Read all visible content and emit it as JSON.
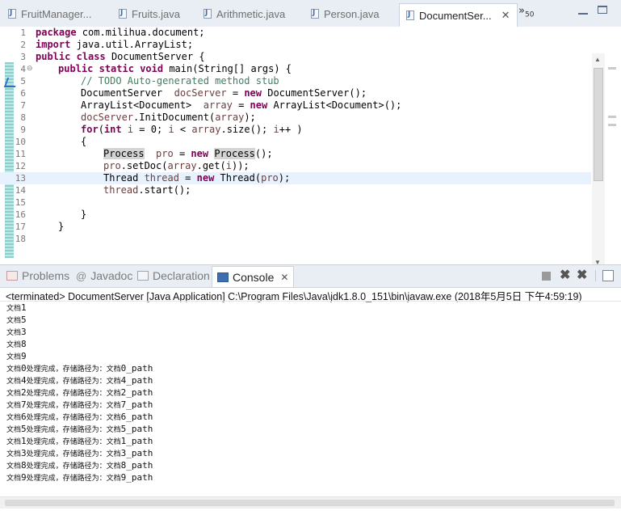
{
  "editor_tabs": [
    {
      "label": "FruitManager..."
    },
    {
      "label": "Fruits.java"
    },
    {
      "label": "Arithmetic.java"
    },
    {
      "label": "Person.java"
    },
    {
      "label": "DocumentSer..."
    }
  ],
  "overflow": {
    "symbol": "»",
    "count": "50"
  },
  "code_lines": [
    {
      "n": "1"
    },
    {
      "n": "2"
    },
    {
      "n": "3"
    },
    {
      "n": "4"
    },
    {
      "n": "5"
    },
    {
      "n": "6"
    },
    {
      "n": "7"
    },
    {
      "n": "8"
    },
    {
      "n": "9"
    },
    {
      "n": "10"
    },
    {
      "n": "11"
    },
    {
      "n": "12"
    },
    {
      "n": "13"
    },
    {
      "n": "14"
    },
    {
      "n": "15"
    },
    {
      "n": "16"
    },
    {
      "n": "17"
    },
    {
      "n": "18"
    }
  ],
  "code": {
    "l1": {
      "kw": "package",
      "rest": " com.milihua.document;"
    },
    "l2": {
      "kw": "import",
      "rest": " java.util.ArrayList;"
    },
    "l3": {
      "kw1": "public",
      "kw2": "class",
      "rest": " DocumentServer {"
    },
    "l4": {
      "kw1": "public",
      "kw2": "static",
      "kw3": "void",
      "rest": " main(String[] args) {"
    },
    "l5": {
      "comment": "// TODO Auto-generated method stub"
    },
    "l6": {
      "a": "DocumentServer  ",
      "var": "docServer",
      "b": " = ",
      "kw": "new",
      "c": " DocumentServer();"
    },
    "l7": {
      "a": "ArrayList<Document>  ",
      "var": "array",
      "b": " = ",
      "kw": "new",
      "c": " ArrayList<Document>();"
    },
    "l8": {
      "var": "docServer",
      "a": ".InitDocument(",
      "var2": "array",
      "b": ");"
    },
    "l9": {
      "kw": "for",
      "a": "(",
      "kw2": "int",
      "b": " ",
      "var": "i",
      "c": " = 0; ",
      "var2": "i",
      "d": " < ",
      "var3": "array",
      "e": ".size(); ",
      "var4": "i",
      "f": "++ )"
    },
    "l10": {
      "a": "{"
    },
    "l11": {
      "mk1": "Process",
      "a": "  ",
      "var": "pro",
      "b": " = ",
      "kw": "new",
      "c": " ",
      "mk2": "Process",
      "d": "();"
    },
    "l12": {
      "var": "pro",
      "a": ".setDoc(",
      "var2": "array",
      "b": ".get(",
      "var3": "i",
      "c": "));"
    },
    "l13": {
      "a": "Thread ",
      "var": "thread",
      "b": " = ",
      "kw": "new",
      "c": " Thread(",
      "var2": "pro",
      "d": ");"
    },
    "l14": {
      "var": "thread",
      "a": ".start();"
    },
    "l16": {
      "a": "}"
    },
    "l17": {
      "a": "}"
    }
  },
  "views": [
    {
      "label": "Problems"
    },
    {
      "label": "Javadoc"
    },
    {
      "label": "Declaration"
    },
    {
      "label": "Console"
    }
  ],
  "console": {
    "status": "<terminated> DocumentServer [Java Application] C:\\Program Files\\Java\\jdk1.8.0_151\\bin\\javaw.exe (2018年5月5日 下午4:59:19)",
    "output": [
      {
        "pre": "文档",
        "tail": "1"
      },
      {
        "pre": "文档",
        "tail": "5"
      },
      {
        "pre": "文档",
        "tail": "3"
      },
      {
        "pre": "文档",
        "tail": "8"
      },
      {
        "pre": "文档",
        "tail": "9"
      },
      {
        "pre": "文档",
        "tail": "0",
        "mid": "处理完成，存储路径为：文档",
        "end": "0_path"
      },
      {
        "pre": "文档",
        "tail": "4",
        "mid": "处理完成，存储路径为：文档",
        "end": "4_path"
      },
      {
        "pre": "文档",
        "tail": "2",
        "mid": "处理完成，存储路径为：文档",
        "end": "2_path"
      },
      {
        "pre": "文档",
        "tail": "7",
        "mid": "处理完成，存储路径为：文档",
        "end": "7_path"
      },
      {
        "pre": "文档",
        "tail": "6",
        "mid": "处理完成，存储路径为：文档",
        "end": "6_path"
      },
      {
        "pre": "文档",
        "tail": "5",
        "mid": "处理完成，存储路径为：文档",
        "end": "5_path"
      },
      {
        "pre": "文档",
        "tail": "1",
        "mid": "处理完成，存储路径为：文档",
        "end": "1_path"
      },
      {
        "pre": "文档",
        "tail": "3",
        "mid": "处理完成，存储路径为：文档",
        "end": "3_path"
      },
      {
        "pre": "文档",
        "tail": "8",
        "mid": "处理完成，存储路径为：文档",
        "end": "8_path"
      },
      {
        "pre": "文档",
        "tail": "9",
        "mid": "处理完成，存储路径为：文档",
        "end": "9_path"
      }
    ]
  },
  "colors": {
    "keyword": "#7f0055",
    "comment": "#3f7f5f",
    "field": "#6a3e3e",
    "current_line": "#e8f2fe"
  }
}
